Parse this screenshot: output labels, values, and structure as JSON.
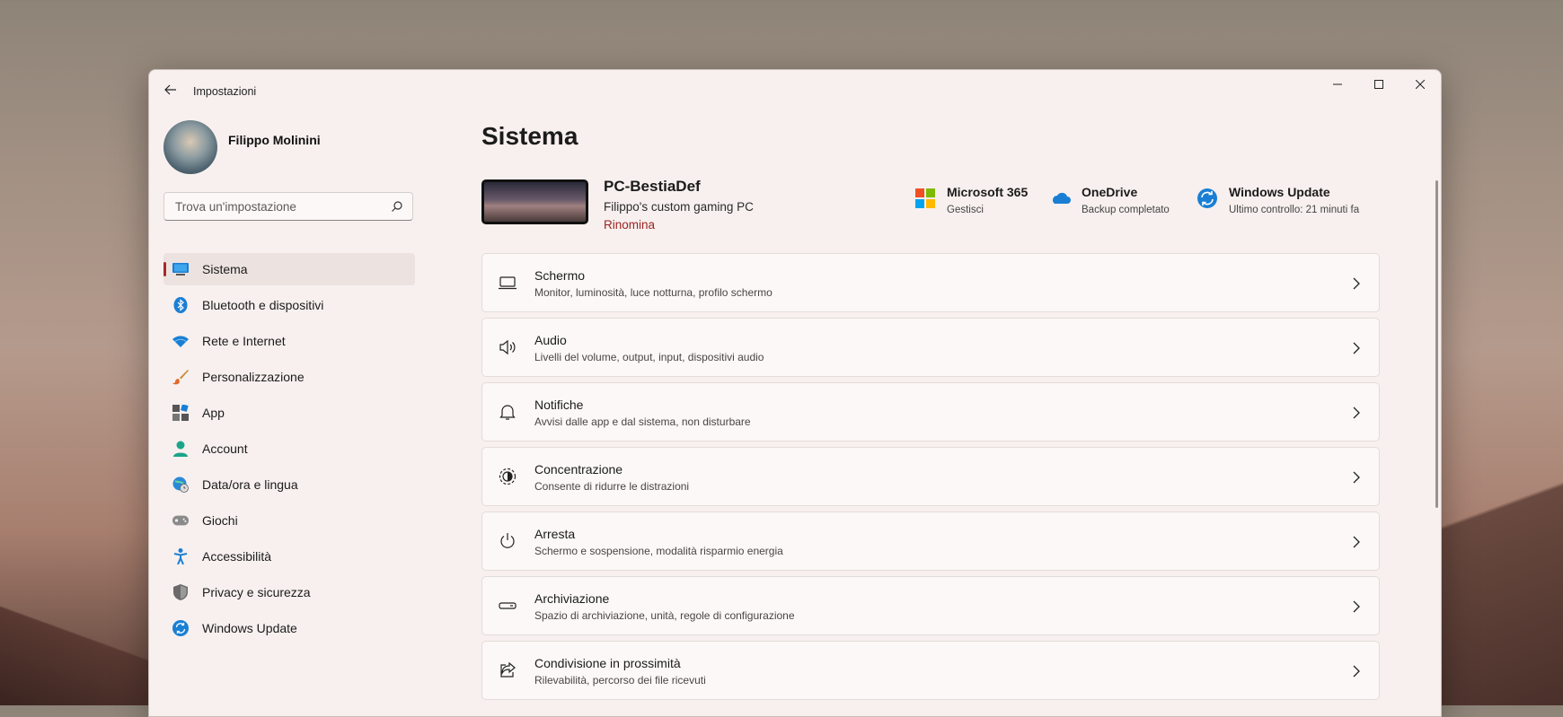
{
  "window": {
    "title": "Impostazioni"
  },
  "profile": {
    "name": "Filippo Molinini"
  },
  "search": {
    "placeholder": "Trova un'impostazione"
  },
  "sidebar": {
    "items": [
      {
        "label": "Sistema",
        "icon": "monitor-icon",
        "active": true
      },
      {
        "label": "Bluetooth e dispositivi",
        "icon": "bluetooth-icon"
      },
      {
        "label": "Rete e Internet",
        "icon": "wifi-icon"
      },
      {
        "label": "Personalizzazione",
        "icon": "brush-icon"
      },
      {
        "label": "App",
        "icon": "apps-icon"
      },
      {
        "label": "Account",
        "icon": "person-icon"
      },
      {
        "label": "Data/ora e lingua",
        "icon": "globe-clock-icon"
      },
      {
        "label": "Giochi",
        "icon": "gamepad-icon"
      },
      {
        "label": "Accessibilità",
        "icon": "accessibility-icon"
      },
      {
        "label": "Privacy e sicurezza",
        "icon": "shield-icon"
      },
      {
        "label": "Windows Update",
        "icon": "update-icon"
      }
    ]
  },
  "main": {
    "title": "Sistema",
    "device": {
      "name": "PC-BestiaDef",
      "description": "Filippo's custom gaming PC",
      "rename": "Rinomina"
    },
    "quick": [
      {
        "title": "Microsoft 365",
        "sub": "Gestisci",
        "icon": "microsoft-logo-icon"
      },
      {
        "title": "OneDrive",
        "sub": "Backup completato",
        "icon": "onedrive-icon"
      },
      {
        "title": "Windows Update",
        "sub": "Ultimo controllo: 21 minuti fa",
        "icon": "update-icon"
      }
    ],
    "cards": [
      {
        "title": "Schermo",
        "sub": "Monitor, luminosità, luce notturna, profilo schermo",
        "icon": "display-icon"
      },
      {
        "title": "Audio",
        "sub": "Livelli del volume, output, input, dispositivi audio",
        "icon": "speaker-icon"
      },
      {
        "title": "Notifiche",
        "sub": "Avvisi dalle app e dal sistema, non disturbare",
        "icon": "bell-icon"
      },
      {
        "title": "Concentrazione",
        "sub": "Consente di ridurre le distrazioni",
        "icon": "focus-icon"
      },
      {
        "title": "Arresta",
        "sub": "Schermo e sospensione, modalità risparmio energia",
        "icon": "power-icon"
      },
      {
        "title": "Archiviazione",
        "sub": "Spazio di archiviazione, unità, regole di configurazione",
        "icon": "storage-icon"
      },
      {
        "title": "Condivisione in prossimità",
        "sub": "Rilevabilità, percorso dei file ricevuti",
        "icon": "share-icon"
      }
    ]
  },
  "colors": {
    "accent": "#a52a2a",
    "rename_link": "#9b2424"
  }
}
